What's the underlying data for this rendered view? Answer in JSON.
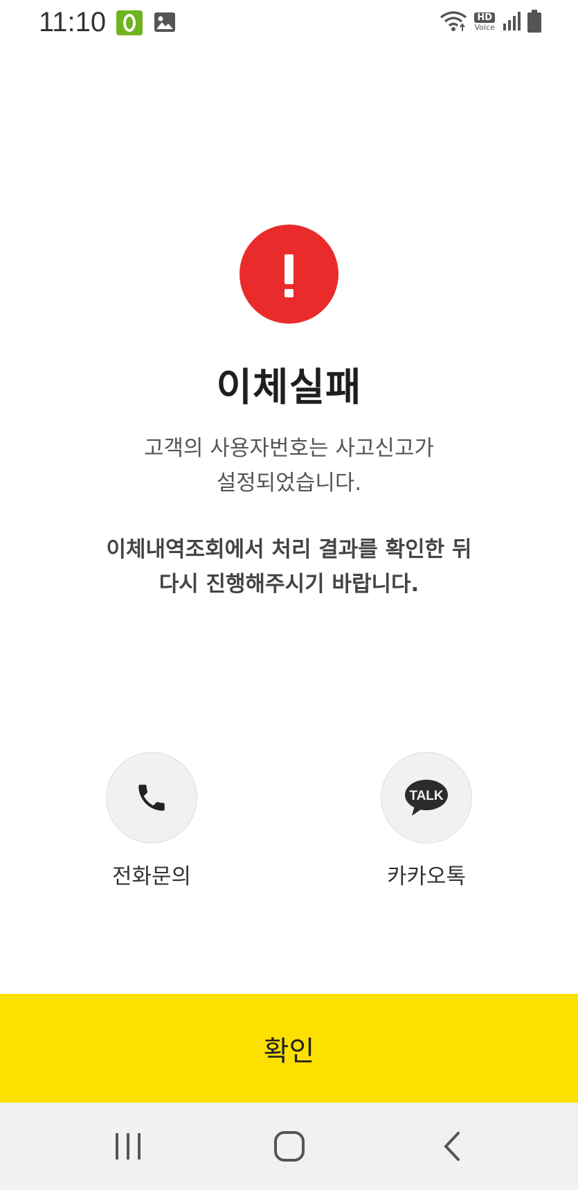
{
  "status_bar": {
    "time": "11:10",
    "hd": "HD",
    "voice": "Voice"
  },
  "alert": {
    "icon": "exclamation-icon",
    "color": "#ea2b2b"
  },
  "title": "이체실패",
  "message": {
    "line1": "고객의 사용자번호는 사고신고가",
    "line2": "설정되었습니다."
  },
  "guide": {
    "line1": "이체내역조회에서 처리 결과를 확인한 뒤",
    "line2": "다시 진행해주시기 바랍니다."
  },
  "contacts": {
    "phone": {
      "label": "전화문의",
      "icon": "phone-icon"
    },
    "talk": {
      "label": "카카오톡",
      "icon": "kakaotalk-icon",
      "badge": "TALK"
    }
  },
  "confirm": {
    "label": "확인",
    "color": "#fbe000"
  }
}
